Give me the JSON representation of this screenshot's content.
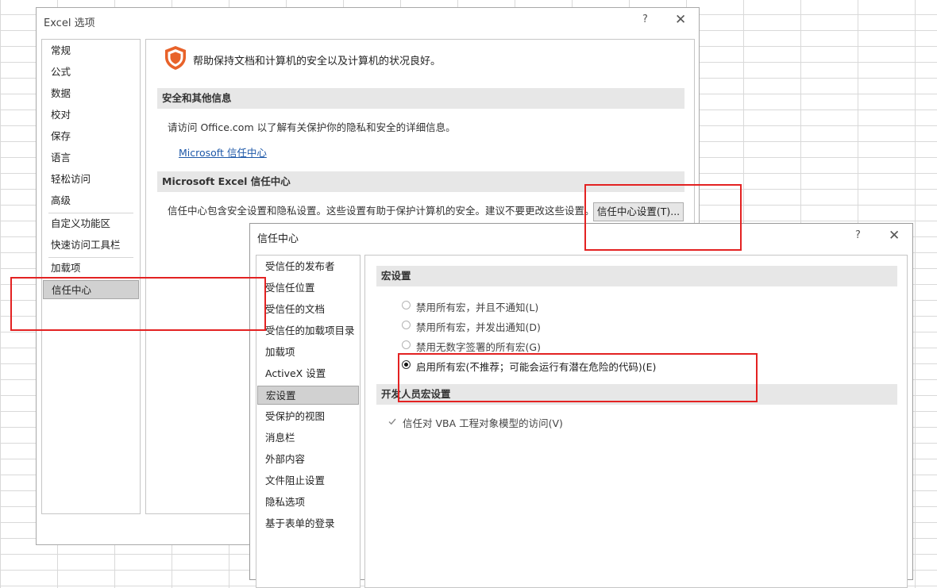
{
  "excel_options": {
    "title": "Excel 选项",
    "help_btn": "?",
    "close_btn": "✕",
    "sidebar": [
      {
        "label": "常规"
      },
      {
        "label": "公式"
      },
      {
        "label": "数据"
      },
      {
        "label": "校对"
      },
      {
        "label": "保存"
      },
      {
        "label": "语言"
      },
      {
        "label": "轻松访问"
      },
      {
        "label": "高级"
      },
      {
        "label": "自定义功能区"
      },
      {
        "label": "快速访问工具栏"
      },
      {
        "label": "加载项"
      },
      {
        "label": "信任中心"
      }
    ],
    "header_text": "帮助保持文档和计算机的安全以及计算机的状况良好。",
    "section1": {
      "title": "安全和其他信息",
      "desc": "请访问 Office.com 以了解有关保护你的隐私和安全的详细信息。",
      "link": "Microsoft 信任中心"
    },
    "section2": {
      "title": "Microsoft Excel 信任中心",
      "desc": "信任中心包含安全设置和隐私设置。这些设置有助于保护计算机的安全。建议不要更改这些设置。",
      "button": "信任中心设置(T)..."
    }
  },
  "trust_center": {
    "title": "信任中心",
    "help_btn": "?",
    "close_btn": "✕",
    "sidebar": [
      {
        "label": "受信任的发布者"
      },
      {
        "label": "受信任位置"
      },
      {
        "label": "受信任的文档"
      },
      {
        "label": "受信任的加载项目录"
      },
      {
        "label": "加载项"
      },
      {
        "label": "ActiveX 设置"
      },
      {
        "label": "宏设置"
      },
      {
        "label": "受保护的视图"
      },
      {
        "label": "消息栏"
      },
      {
        "label": "外部内容"
      },
      {
        "label": "文件阻止设置"
      },
      {
        "label": "隐私选项"
      },
      {
        "label": "基于表单的登录"
      }
    ],
    "macro_section": "宏设置",
    "options": [
      {
        "label": "禁用所有宏，并且不通知(L)",
        "checked": false
      },
      {
        "label": "禁用所有宏，并发出通知(D)",
        "checked": false
      },
      {
        "label": "禁用无数字签署的所有宏(G)",
        "checked": false
      },
      {
        "label": "启用所有宏(不推荐；可能会运行有潜在危险的代码)(E)",
        "checked": true
      }
    ],
    "dev_section": "开发人员宏设置",
    "vba_checkbox": {
      "label": "信任对 VBA 工程对象模型的访问(V)",
      "checked": true
    }
  },
  "colors": {
    "highlight_box": "#e32222",
    "shield": "#e8622a",
    "link": "#1e58a8"
  },
  "icons": {
    "shield": "shield-icon",
    "checkmark": "checkmark-icon"
  }
}
